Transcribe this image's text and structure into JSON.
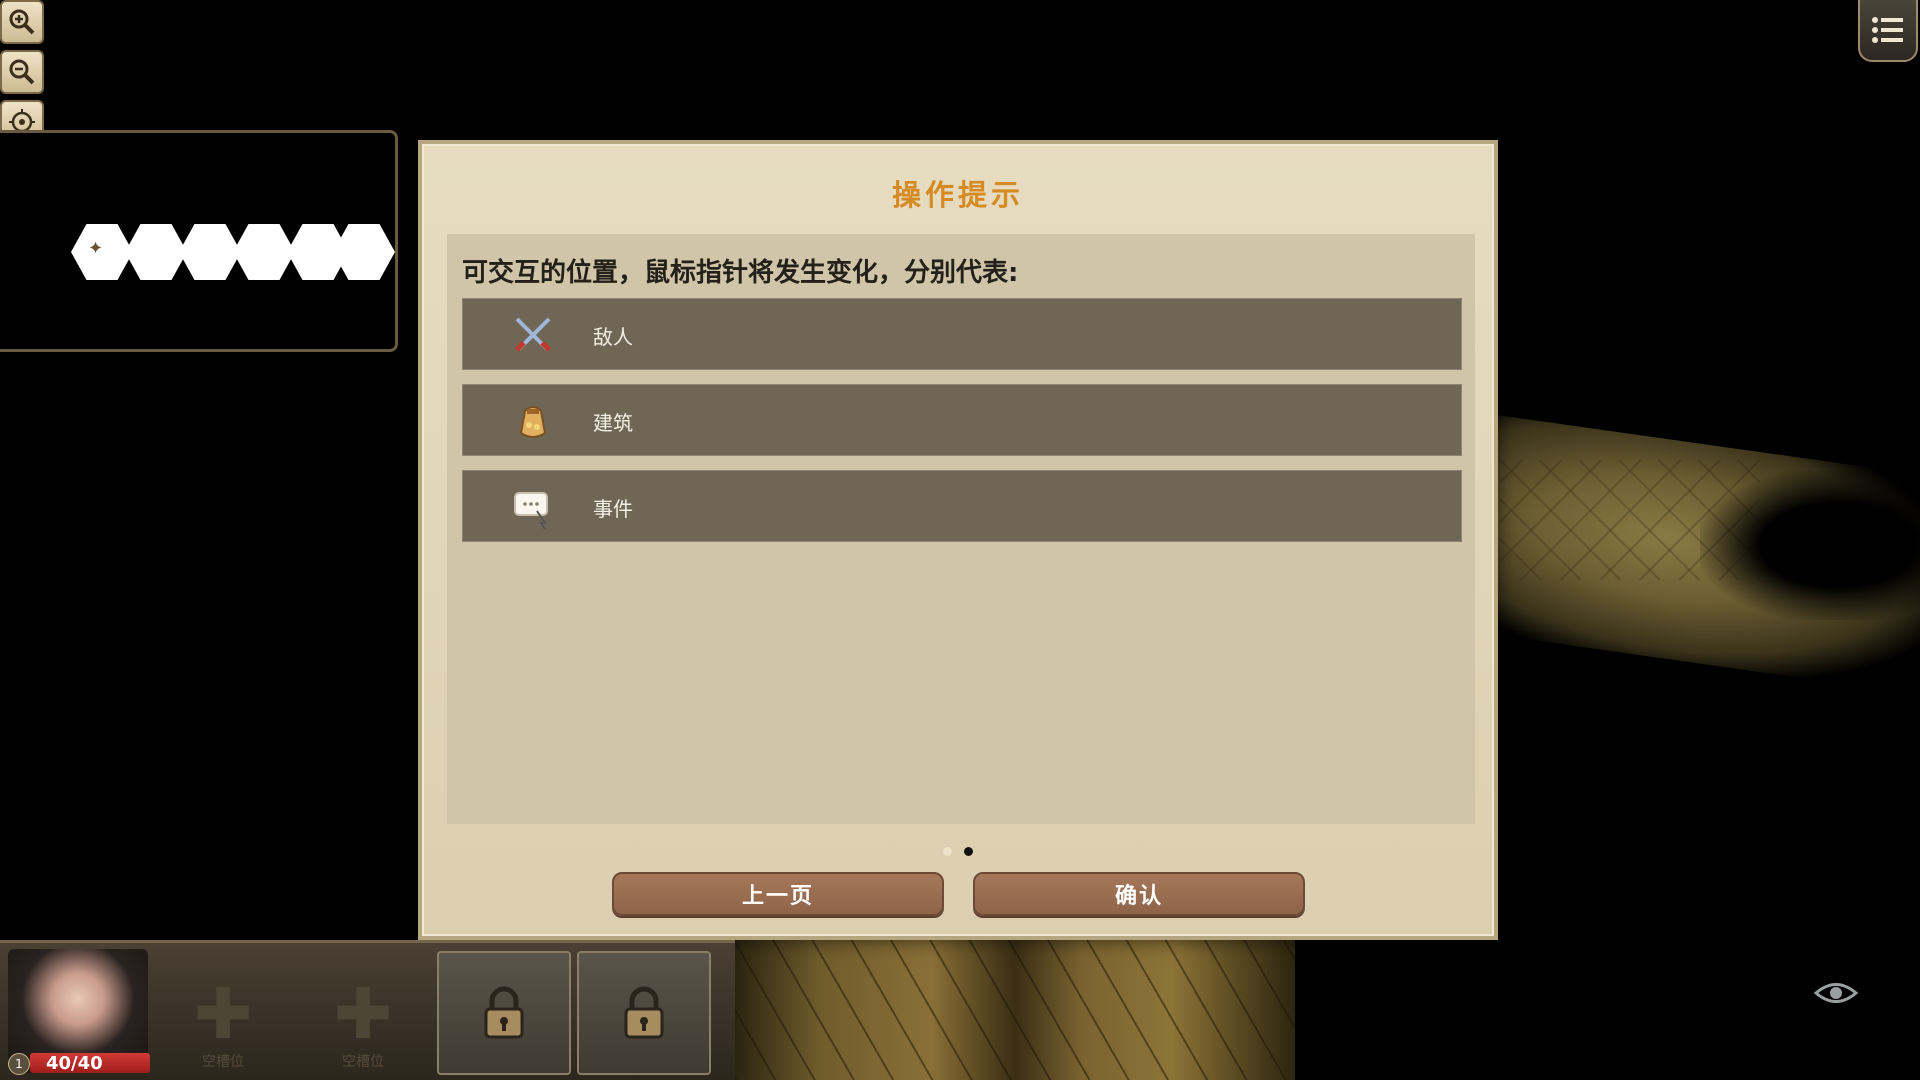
{
  "dialog": {
    "title": "操作提示",
    "instruction": "可交互的位置，鼠标指针将发生变化，分别代表:",
    "rows": [
      {
        "label": "敌人",
        "icon": "crossed-swords-icon"
      },
      {
        "label": "建筑",
        "icon": "treasure-bag-icon"
      },
      {
        "label": "事件",
        "icon": "speech-bubble-icon"
      }
    ],
    "page_indicator": {
      "total": 2,
      "current": 2
    },
    "prev_button": "上一页",
    "confirm_button": "确认"
  },
  "hud": {
    "zoom_controls": [
      "zoom-in-icon",
      "zoom-out-icon",
      "locate-icon"
    ],
    "menu_icon": "menu-list-icon",
    "view_toggle_icon": "eye-icon"
  },
  "party": {
    "leader": {
      "hp": "40/40",
      "level": "1"
    },
    "add_slots": [
      {
        "caption": "空槽位"
      },
      {
        "caption": "空槽位"
      }
    ],
    "locked_slots": 2
  },
  "colors": {
    "title": "#d68a23",
    "panel": "#e7dcc0",
    "row": "#6f6656",
    "button": "#9a6e52",
    "hp": "#c5302c"
  }
}
